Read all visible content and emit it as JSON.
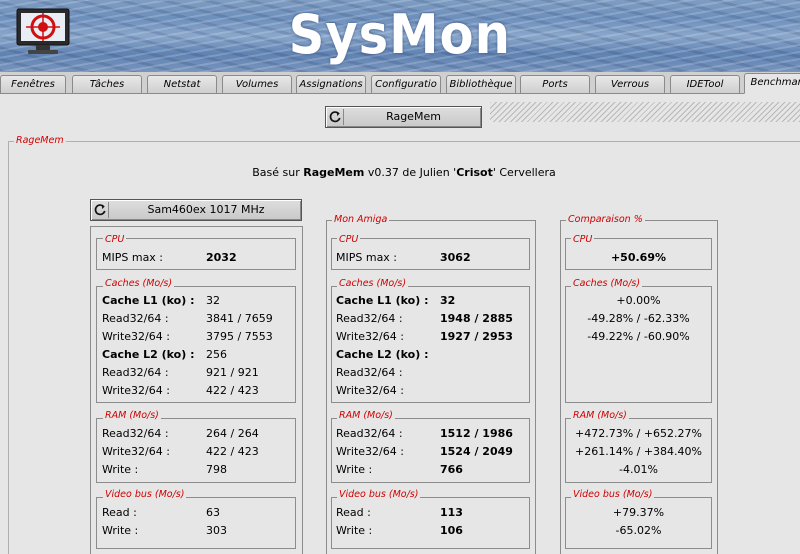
{
  "app": {
    "title": "SysMon"
  },
  "tabs": [
    "Fenêtres",
    "Tâches",
    "Netstat",
    "Volumes",
    "Assignations",
    "Configuratio",
    "Bibliothèque",
    "Ports",
    "Verrous",
    "IDETool",
    "Benchmark"
  ],
  "toolbar": {
    "ragemem_button": "RageMem"
  },
  "main": {
    "legend": "RageMem",
    "subtitle": {
      "prefix": "Basé sur ",
      "name": "RageMem",
      "mid": " v0.37 de Julien '",
      "nick": "Crisot",
      "suffix": "' Cervellera"
    }
  },
  "machine_button": "Sam460ex 1017 MHz",
  "groups": {
    "my_amiga": "Mon Amiga",
    "compare": "Comparaison %"
  },
  "section_titles": {
    "cpu": "CPU",
    "caches": "Caches (Mo/s)",
    "ram": "RAM (Mo/s)",
    "video": "Video bus (Mo/s)"
  },
  "labels": {
    "mips": "MIPS max :",
    "cache_l1": "Cache L1 (ko) :",
    "cache_l2": "Cache L2 (ko) :",
    "read": "Read32/64 :",
    "write": "Write32/64 :",
    "write_simple": "Write :",
    "read_simple": "Read :"
  },
  "reference": {
    "mips": "2032",
    "cache_l1": "32",
    "l1_read": "3841 / 7659",
    "l1_write": "3795 / 7553",
    "cache_l2": "256",
    "l2_read": "921 / 921",
    "l2_write": "422 / 423",
    "ram_read": "264 / 264",
    "ram_write": "422 / 423",
    "ram_write_simple": "798",
    "video_read": "63",
    "video_write": "303"
  },
  "mine": {
    "mips": "3062",
    "cache_l1": "32",
    "l1_read": "1948 / 2885",
    "l1_write": "1927 / 2953",
    "ram_read": "1512 / 1986",
    "ram_write": "1524 / 2049",
    "ram_write_simple": "766",
    "video_read": "113",
    "video_write": "106"
  },
  "comparison": {
    "cpu": "+50.69%",
    "cache_l1": "+0.00%",
    "l1_read": "-49.28% / -62.33%",
    "l1_write": "-49.22% / -60.90%",
    "ram_read": "+472.73% / +652.27%",
    "ram_write": "+261.14% / +384.40%",
    "ram_write_simple": "-4.01%",
    "video_read": "+79.37%",
    "video_write": "-65.02%"
  }
}
